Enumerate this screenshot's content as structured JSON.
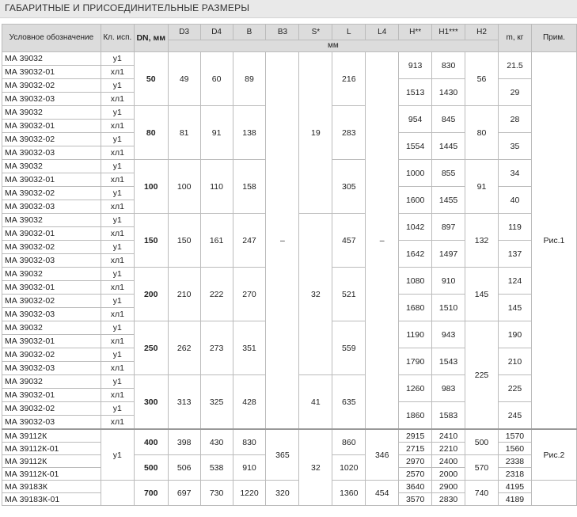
{
  "title": "ГАБАРИТНЫЕ И ПРИСОЕДИНИТЕЛЬНЫЕ РАЗМЕРЫ",
  "headers": {
    "designation": "Условное обозначение",
    "version": "Кл. исп.",
    "dn": "DN, мм",
    "d3": "D3",
    "d4": "D4",
    "b": "B",
    "b3": "B3",
    "s": "S*",
    "l": "L",
    "l4": "L4",
    "h": "H**",
    "h1": "H1***",
    "h2": "H2",
    "m": "m, кг",
    "note": "Прим.",
    "mm": "мм"
  },
  "designations": {
    "a": "МА 39032",
    "b": "МА 39032-01",
    "c": "МА 39032-02",
    "d": "МА 39032-03",
    "e": "МА 39112К",
    "f": "МА 39112К-01",
    "g": "МА 39183К",
    "h": "МА 39183К-01"
  },
  "versions": {
    "u1": "у1",
    "hl1": "хл1"
  },
  "dash": "–",
  "groups": [
    {
      "dn": "50",
      "d3": "49",
      "d4": "60",
      "b": "89",
      "l": "216",
      "h_a": "913",
      "h1_a": "830",
      "h_b": "1513",
      "h1_b": "1430",
      "h2": "56",
      "m_a": "21.5",
      "m_b": "29"
    },
    {
      "dn": "80",
      "d3": "81",
      "d4": "91",
      "b": "138",
      "s": "19",
      "l": "283",
      "h_a": "954",
      "h1_a": "845",
      "h_b": "1554",
      "h1_b": "1445",
      "h2": "80",
      "m_a": "28",
      "m_b": "35"
    },
    {
      "dn": "100",
      "d3": "100",
      "d4": "110",
      "b": "158",
      "l": "305",
      "h_a": "1000",
      "h1_a": "855",
      "h_b": "1600",
      "h1_b": "1455",
      "h2": "91",
      "m_a": "34",
      "m_b": "40"
    },
    {
      "dn": "150",
      "d3": "150",
      "d4": "161",
      "b": "247",
      "l": "457",
      "h_a": "1042",
      "h1_a": "897",
      "h_b": "1642",
      "h1_b": "1497",
      "h2": "132",
      "m_a": "119",
      "m_b": "137"
    },
    {
      "dn": "200",
      "d3": "210",
      "d4": "222",
      "b": "270",
      "s": "32",
      "l": "521",
      "h_a": "1080",
      "h1_a": "910",
      "h_b": "1680",
      "h1_b": "1510",
      "h2": "145",
      "m_a": "124",
      "m_b": "145"
    },
    {
      "dn": "250",
      "d3": "262",
      "d4": "273",
      "b": "351",
      "l": "559",
      "h_a": "1190",
      "h1_a": "943",
      "h_b": "1790",
      "h1_b": "1543",
      "m_a": "190",
      "m_b": "210"
    },
    {
      "dn": "300",
      "d3": "313",
      "d4": "325",
      "b": "428",
      "s": "41",
      "l": "635",
      "h_a": "1260",
      "h1_a": "983",
      "h_b": "1860",
      "h1_b": "1583",
      "h2": "225",
      "m_a": "225",
      "m_b": "245"
    }
  ],
  "note1": "Рис.1",
  "note2": "Рис.2",
  "big": {
    "b3_400": "365",
    "s_400": "32",
    "l4_400": "346",
    "g400": {
      "dn": "400",
      "d3": "398",
      "d4": "430",
      "b": "830",
      "l": "860",
      "h": [
        "2915",
        "2715"
      ],
      "h1": [
        "2410",
        "2210"
      ],
      "h2": "500",
      "m": [
        "1570",
        "1560"
      ]
    },
    "g500": {
      "dn": "500",
      "d3": "506",
      "d4": "538",
      "b": "910",
      "l": "1020",
      "h": [
        "2970",
        "2570"
      ],
      "h1": [
        "2400",
        "2000"
      ],
      "h2": "570",
      "m": [
        "2338",
        "2318"
      ]
    },
    "g700": {
      "dn": "700",
      "d3": "697",
      "d4": "730",
      "b": "1220",
      "b3": "320",
      "l": "1360",
      "l4": "454",
      "h": [
        "3640",
        "3570"
      ],
      "h1": [
        "2900",
        "2830"
      ],
      "h2": "740",
      "m": [
        "4195",
        "4189"
      ]
    }
  }
}
